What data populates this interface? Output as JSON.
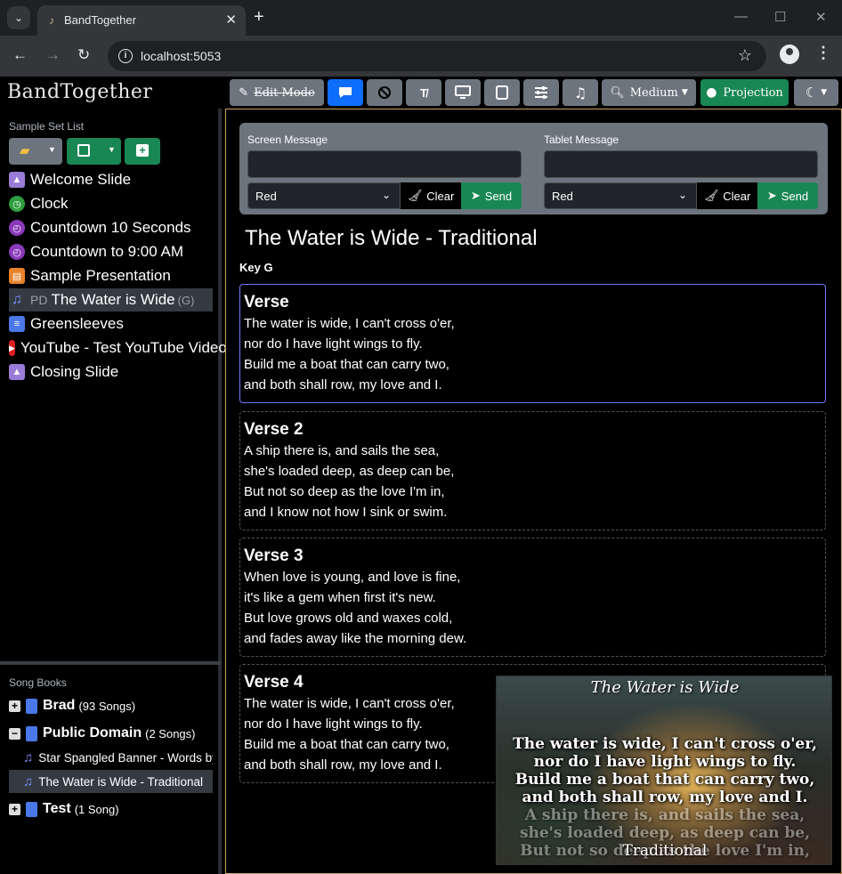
{
  "browser": {
    "tab_title": "BandTogether",
    "url": "localhost:5053"
  },
  "app": {
    "brand": "BandTogether",
    "toolbar": {
      "edit_mode": "Edit Mode",
      "size": "Medium",
      "projection": "Projection"
    }
  },
  "setlist": {
    "title": "Sample Set List",
    "items": [
      {
        "label": "Welcome Slide",
        "icon": "image-icon",
        "color": "#9b7bd8"
      },
      {
        "label": "Clock",
        "icon": "clock-icon",
        "color": "#2e9e3e"
      },
      {
        "label": "Countdown 10 Seconds",
        "icon": "stopwatch-icon",
        "color": "#8a3ab9"
      },
      {
        "label": "Countdown to 9:00 AM",
        "icon": "stopwatch-icon",
        "color": "#8a3ab9"
      },
      {
        "label": "Sample Presentation",
        "icon": "presentation-icon",
        "color": "#e8822a"
      },
      {
        "label": "The Water is Wide",
        "prefix": "PD",
        "key": "(G)",
        "icon": "music-note-icon",
        "color": "#7b8cff"
      },
      {
        "label": "Greensleeves",
        "icon": "document-icon",
        "color": "#4a78e8"
      },
      {
        "label": "YouTube - Test YouTube Video",
        "icon": "youtube-icon",
        "color": "#e02020"
      },
      {
        "label": "Closing Slide",
        "icon": "image-icon",
        "color": "#9b7bd8"
      }
    ]
  },
  "songbooks": {
    "title": "Song Books",
    "books": [
      {
        "name": "Brad",
        "count": "(93 Songs)",
        "toggle": "+"
      },
      {
        "name": "Public Domain",
        "count": "(2 Songs)",
        "toggle": "−"
      },
      {
        "name": "Test",
        "count": "(1 Song)",
        "toggle": "+"
      }
    ],
    "songs": [
      "Star Spangled Banner - Words by...",
      "The Water is Wide - Traditional"
    ]
  },
  "messages": {
    "screen_label": "Screen Message",
    "tablet_label": "Tablet Message",
    "screen_color": "Red",
    "tablet_color": "Red",
    "clear": "Clear",
    "send": "Send"
  },
  "song": {
    "title": "The Water is Wide - Traditional",
    "key": "Key G",
    "verses": [
      {
        "title": "Verse",
        "lines": [
          "The water is wide, I can't cross o'er,",
          "nor do I have light wings to fly.",
          "Build me a boat that can carry two,",
          "and both shall row, my love and I."
        ]
      },
      {
        "title": "Verse 2",
        "lines": [
          "A ship there is, and sails the sea,",
          "she's loaded deep, as deep can be,",
          "But not so deep as the love I'm in,",
          "and I know not how I sink or swim."
        ]
      },
      {
        "title": "Verse 3",
        "lines": [
          "When love is young, and love is fine,",
          "it's like a gem when first it's new.",
          "But love grows old and waxes cold,",
          "and fades away like the morning dew."
        ]
      },
      {
        "title": "Verse 4",
        "lines": [
          "The water is wide, I can't cross o'er,",
          "nor do I have light wings to fly.",
          "Build me a boat that can carry two,",
          "and both shall row, my love and I."
        ]
      }
    ]
  },
  "preview": {
    "title": "The Water is Wide",
    "lines": [
      "The water is wide, I can't cross o'er,",
      "nor do I have light wings to fly.",
      "Build me a boat that can carry two,",
      "and both shall row, my love and I."
    ],
    "dim_lines": [
      "A ship there is, and sails the sea,",
      "she's loaded deep, as deep can be,",
      "But not so deep as the love I'm in,"
    ],
    "footer": "Traditional"
  }
}
